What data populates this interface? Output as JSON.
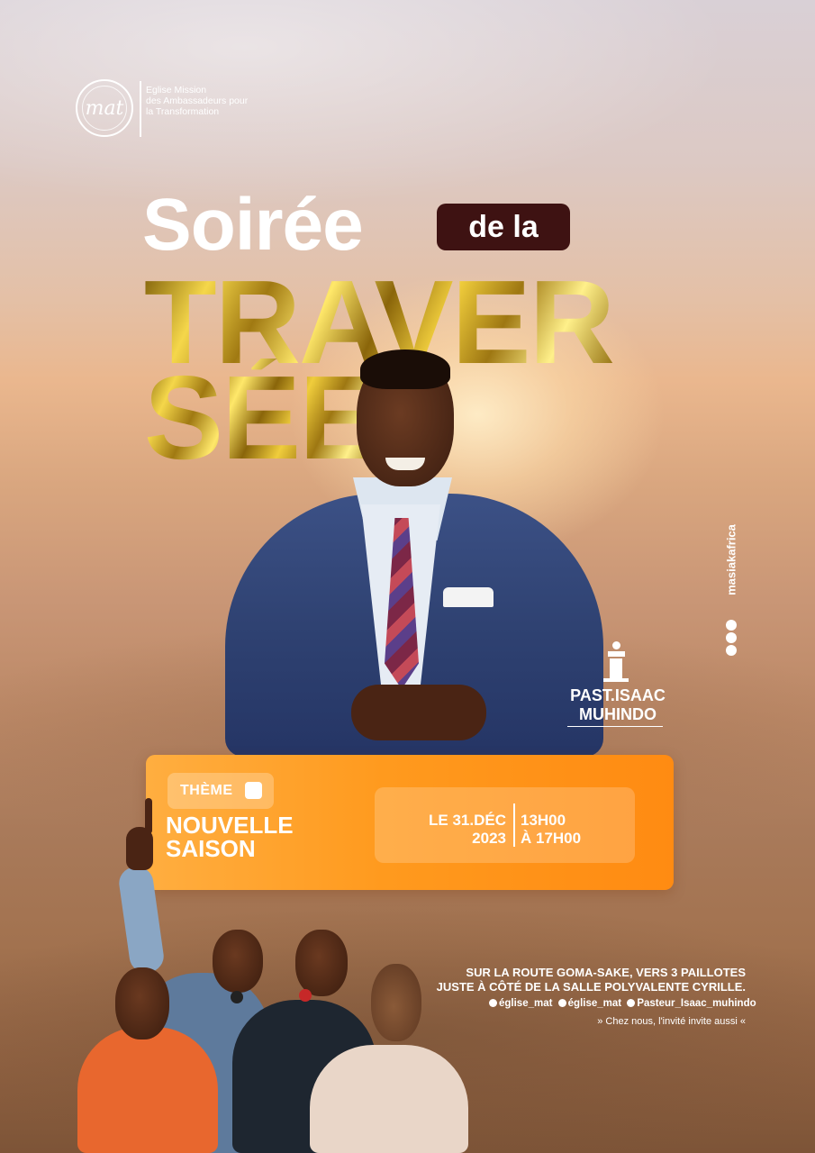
{
  "brand": {
    "logo_monogram": "mat",
    "church_name": [
      "Eglise Mission",
      "des Ambassadeurs pour",
      "la Transformation"
    ]
  },
  "title": {
    "line1": "Soirée",
    "badge": "de la",
    "line2": "TRAVER",
    "line3": "SÉE"
  },
  "designer": {
    "handle": "masiakafrica",
    "icons": [
      "facebook-icon",
      "instagram-icon",
      "youtube-icon"
    ]
  },
  "speaker": {
    "name": [
      "PAST.ISAAC",
      "MUHINDO"
    ],
    "icon": "pulpit-icon"
  },
  "event": {
    "theme_label": "THÈME",
    "theme_title": [
      "NOUVELLE",
      "SAISON"
    ],
    "date": [
      "LE 31.DÉC",
      "2023"
    ],
    "time": [
      "13H00",
      "À 17H00"
    ]
  },
  "location": {
    "address": [
      "SUR LA ROUTE GOMA-SAKE, VERS 3 PAILLOTES",
      "JUSTE À CÔTÉ DE LA SALLE POLYVALENTE CYRILLE."
    ],
    "socials": [
      {
        "icon": "facebook-icon",
        "label": "église_mat"
      },
      {
        "icon": "instagram-icon",
        "label": "église_mat"
      },
      {
        "icon": "youtube-icon",
        "label": "Pasteur_Isaac_muhindo"
      }
    ],
    "tagline": "» Chez nous, l'invité invite aussi «"
  },
  "colors": {
    "accent_orange": "#ff9a1e",
    "badge_brown": "#3e1212",
    "gold": "#e6c23a"
  }
}
